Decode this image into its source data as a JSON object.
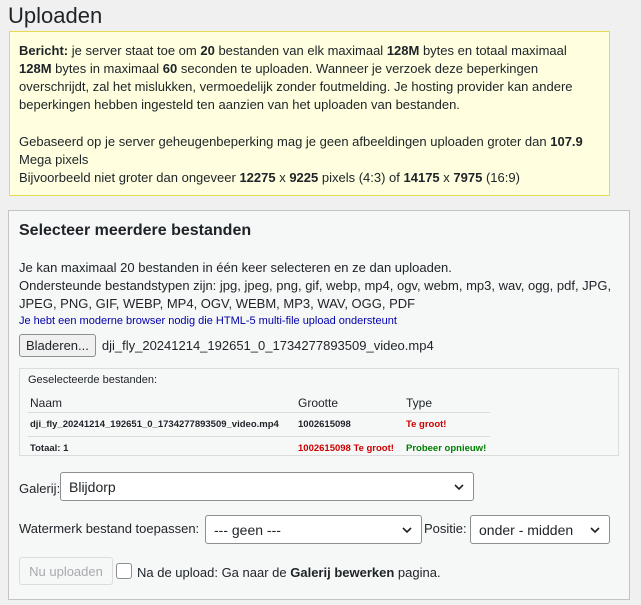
{
  "page": {
    "title": "Uploaden"
  },
  "notice": {
    "p1": [
      {
        "t": "Bericht:",
        "b": true
      },
      {
        "t": " je server staat toe om ",
        "b": false
      },
      {
        "t": "20",
        "b": true
      },
      {
        "t": " bestanden van elk maximaal ",
        "b": false
      },
      {
        "t": "128M",
        "b": true
      },
      {
        "t": " bytes en totaal maximaal ",
        "b": false
      },
      {
        "t": "128M",
        "b": true
      },
      {
        "t": " bytes in maximaal ",
        "b": false
      },
      {
        "t": "60",
        "b": true
      },
      {
        "t": " seconden te uploaden. Wanneer je verzoek deze beperkingen overschrijdt, zal het mislukken, vermoedelijk zonder foutmelding. Je hosting provider kan andere beperkingen hebben ingesteld ten aanzien van het uploaden van bestanden.",
        "b": false
      }
    ],
    "p2": [
      {
        "t": "Gebaseerd op je server geheugenbeperking mag je geen afbeeldingen uploaden groter dan ",
        "b": false
      },
      {
        "t": "107.9",
        "b": true
      },
      {
        "t": " Mega pixels",
        "b": false
      }
    ],
    "p3": [
      {
        "t": "Bijvoorbeeld niet groter dan ongeveer ",
        "b": false
      },
      {
        "t": "12275",
        "b": true
      },
      {
        "t": " x ",
        "b": false
      },
      {
        "t": "9225",
        "b": true
      },
      {
        "t": " pixels (4:3) of ",
        "b": false
      },
      {
        "t": "14175",
        "b": true
      },
      {
        "t": " x ",
        "b": false
      },
      {
        "t": "7975",
        "b": true
      },
      {
        "t": " (16:9)",
        "b": false
      }
    ]
  },
  "panel": {
    "title": "Selecteer meerdere bestanden",
    "line1": "Je kan maximaal 20 bestanden in één keer selecteren en ze dan uploaden.",
    "line2": "Ondersteunde bestandstypen zijn: jpg, jpeg, png, gif, webp, mp4, ogv, webm, mp3, wav, ogg, pdf, JPG, JPEG, PNG, GIF, WEBP, MP4, OGV, WEBM, MP3, WAV, OGG, PDF",
    "browser_note": "Je hebt een moderne browser nodig die HTML-5 multi-file upload ondersteunt",
    "browse_label": "Bladeren...",
    "chosen_file": "dji_fly_20241214_192651_0_1734277893509_video.mp4"
  },
  "selected": {
    "title": "Geselecteerde bestanden:",
    "headers": {
      "name": "Naam",
      "size": "Grootte",
      "type": "Type"
    },
    "row": {
      "name": "dji_fly_20241214_192651_0_1734277893509_video.mp4",
      "size": "1002615098",
      "type": "Te groot!"
    },
    "total": {
      "label": "Totaal: 1",
      "size": "1002615098 Te groot!",
      "type": "Probeer opnieuw!"
    }
  },
  "form": {
    "gallery_label": "Galerij:",
    "gallery_value": "Blijdorp",
    "watermark_label": "Watermerk bestand toepassen:",
    "watermark_value": "--- geen ---",
    "position_label": "Positie:",
    "position_value": "onder - midden",
    "upload_label": "Nu uploaden",
    "after_prefix": "Na de upload: Ga naar de ",
    "after_bold": "Galerij bewerken",
    "after_suffix": " pagina."
  },
  "colors": {
    "error": "#cc0000",
    "ok": "#008000",
    "notice_bg": "#ffffe0",
    "notice_border": "#e6db55"
  }
}
